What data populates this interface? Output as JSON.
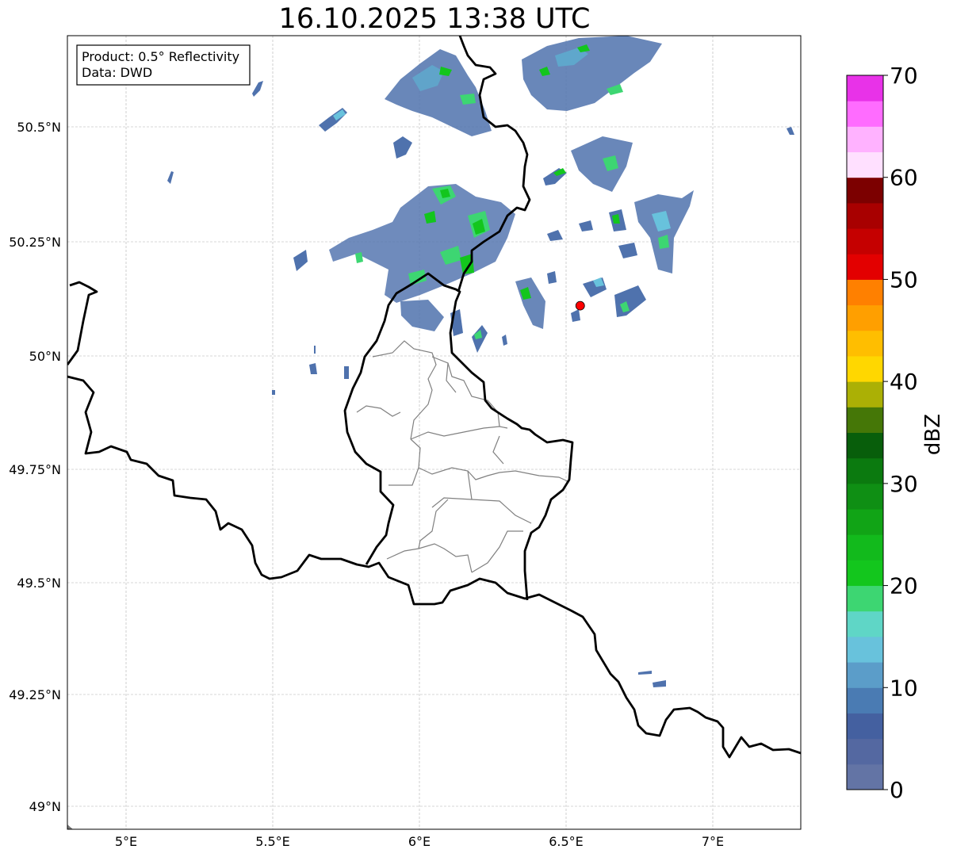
{
  "title": "16.10.2025 13:38 UTC",
  "info_box": {
    "line1": "Product: 0.5° Reflectivity",
    "line2": "Data: DWD"
  },
  "map": {
    "lon_range": [
      4.8,
      7.3
    ],
    "lat_range": [
      48.95,
      50.7
    ],
    "gridlines": true,
    "lon_ticks": [
      {
        "value": 5.0,
        "label": "5°E"
      },
      {
        "value": 5.5,
        "label": "5.5°E"
      },
      {
        "value": 6.0,
        "label": "6°E"
      },
      {
        "value": 6.5,
        "label": "6.5°E"
      },
      {
        "value": 7.0,
        "label": "7°E"
      }
    ],
    "lat_ticks": [
      {
        "value": 49.0,
        "label": "49°N"
      },
      {
        "value": 49.25,
        "label": "49.25°N"
      },
      {
        "value": 49.5,
        "label": "49.5°N"
      },
      {
        "value": 49.75,
        "label": "49.75°N"
      },
      {
        "value": 50.0,
        "label": "50°N"
      },
      {
        "value": 50.25,
        "label": "50.25°N"
      },
      {
        "value": 50.5,
        "label": "50.5°N"
      }
    ],
    "radar_site_marker": {
      "lon": 6.548,
      "lat": 50.11,
      "color": "#ff0000"
    }
  },
  "colorbar": {
    "label": "dBZ",
    "min": 0,
    "max": 70,
    "ticks": [
      {
        "value": 0,
        "label": "0"
      },
      {
        "value": 10,
        "label": "10"
      },
      {
        "value": 20,
        "label": "20"
      },
      {
        "value": 30,
        "label": "30"
      },
      {
        "value": 40,
        "label": "40"
      },
      {
        "value": 50,
        "label": "50"
      },
      {
        "value": 60,
        "label": "60"
      },
      {
        "value": 70,
        "label": "70"
      }
    ],
    "colors": [
      "#6374a5",
      "#5468a1",
      "#4460a0",
      "#4a7bb3",
      "#5b9dc9",
      "#68c2dc",
      "#5fd6c6",
      "#3dd672",
      "#13c61d",
      "#12ba1c",
      "#11a416",
      "#0f8f14",
      "#0b7a0f",
      "#085e0b",
      "#457707",
      "#abb005",
      "#ffd700",
      "#ffbe00",
      "#ff9f00",
      "#ff8000",
      "#e30000",
      "#c50000",
      "#a80000",
      "#7c0000",
      "#ffe0ff",
      "#ffb2ff",
      "#ff6cff",
      "#e832e8"
    ]
  }
}
